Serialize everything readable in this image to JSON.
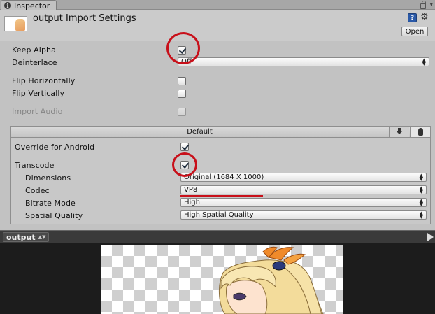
{
  "tab": {
    "title": "Inspector",
    "icon": "info-icon"
  },
  "header": {
    "title": "output Import Settings",
    "open_label": "Open",
    "help_icon": "help-icon",
    "gear_icon": "gear-icon"
  },
  "fields": {
    "keep_alpha": {
      "label": "Keep Alpha",
      "checked": true
    },
    "deinterlace": {
      "label": "Deinterlace",
      "value": "Off"
    },
    "flip_horizontally": {
      "label": "Flip Horizontally",
      "checked": false
    },
    "flip_vertically": {
      "label": "Flip Vertically",
      "checked": false
    },
    "import_audio": {
      "label": "Import Audio",
      "checked": false,
      "disabled": true
    }
  },
  "platform": {
    "default_tab": "Default",
    "standalone_icon": "download-icon",
    "android_icon": "android-icon",
    "override": {
      "label": "Override for Android",
      "checked": true
    },
    "transcode": {
      "label": "Transcode",
      "checked": true
    },
    "dimensions": {
      "label": "Dimensions",
      "value": "Original (1684 X 1000)"
    },
    "codec": {
      "label": "Codec",
      "value": "VP8"
    },
    "bitrate_mode": {
      "label": "Bitrate Mode",
      "value": "High"
    },
    "spatial_quality": {
      "label": "Spatial Quality",
      "value": "High Spatial Quality"
    }
  },
  "annotations": {
    "color": "#c8101a"
  },
  "preview": {
    "selected": "output"
  }
}
